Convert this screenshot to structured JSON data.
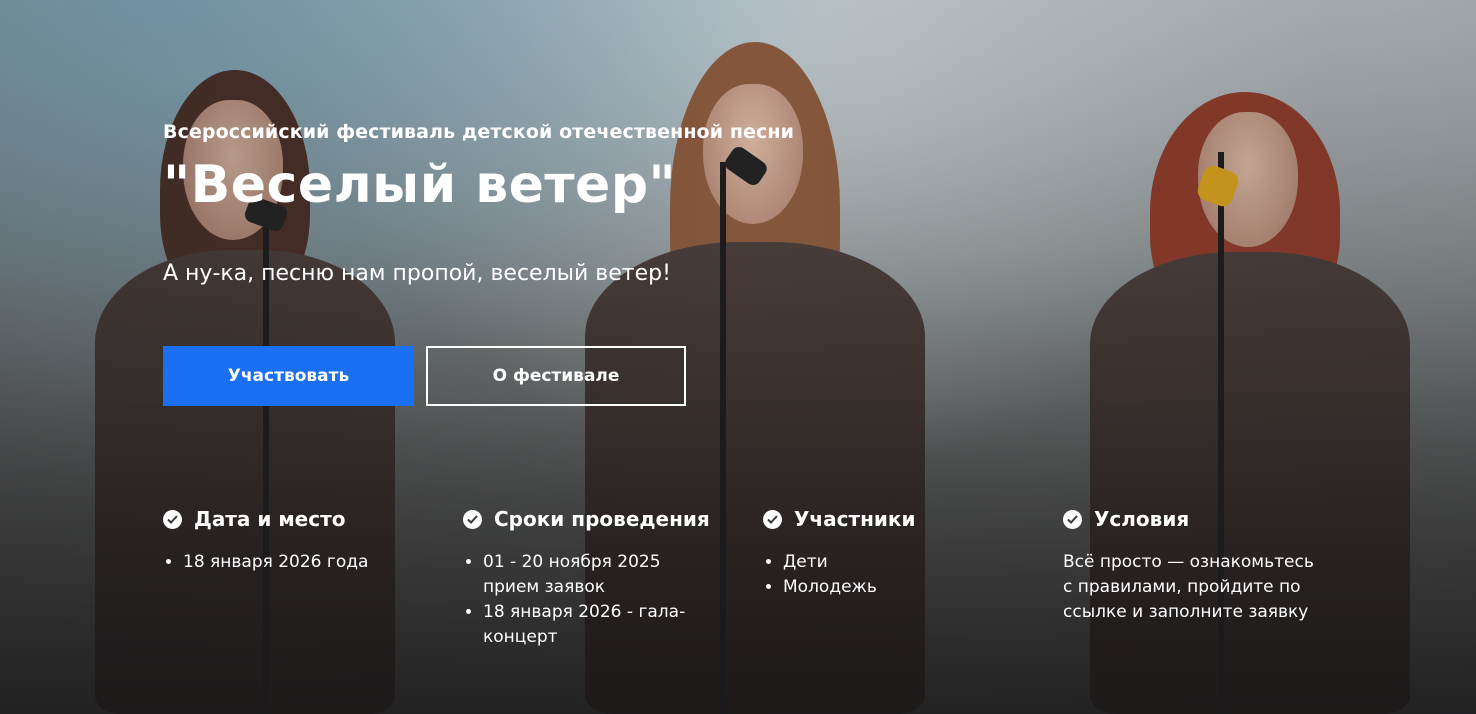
{
  "hero": {
    "subtitle": "Всероссийский фестиваль детской отечественной песни",
    "title": "\"Веселый ветер\"",
    "tagline": "А ну-ка, песню нам пропой, веселый ветер!",
    "primary_button": "Участвовать",
    "secondary_button": "О фестивале"
  },
  "info": {
    "date_place": {
      "heading": "Дата и место",
      "items": [
        "18 января 2026 года"
      ]
    },
    "schedule": {
      "heading": "Сроки проведения",
      "items": [
        "01 - 20 ноября 2025 прием заявок",
        "18 января 2026 - гала-концерт"
      ]
    },
    "participants": {
      "heading": "Участники",
      "items": [
        "Дети",
        "Молодежь"
      ]
    },
    "conditions": {
      "heading": "Условия",
      "text": "Всё просто — ознакомьтесь с правилами, пройдите по ссылке и заполните заявку"
    }
  },
  "colors": {
    "primary_button": "#1a6ff2",
    "text": "#ffffff"
  },
  "icons": {
    "info_heading": "check-circle-icon",
    "background": "singers-photo"
  }
}
